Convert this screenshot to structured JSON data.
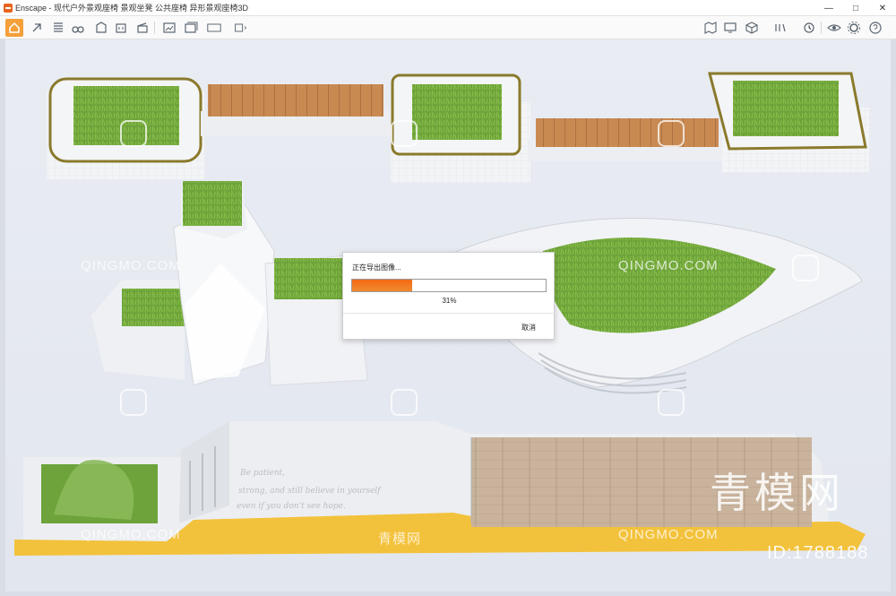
{
  "window": {
    "title": "Enscape - 现代户外景观座椅 景观坐凳 公共座椅 异形景观座椅3D",
    "controls": [
      "—",
      "□",
      "✕"
    ]
  },
  "toolbar": {
    "icons": [
      "home-icon",
      "asset-icon",
      "batch-icon",
      "bim-icon",
      "binoculars-icon",
      "building-icon",
      "gallery-icon",
      "clapper-icon",
      "export-image-icon",
      "export-batch-icon",
      "export-360-icon",
      "export-web-icon",
      "map-icon",
      "monitor-icon",
      "cube-icon",
      "vr-icon",
      "settings-advanced-icon",
      "eye-icon",
      "gear-icon",
      "help-icon"
    ]
  },
  "scene": {
    "inscription": [
      "Be patient,",
      "strong, and still believe in yourself",
      "even if you don't see hope."
    ]
  },
  "watermarks": {
    "text": "QINGMO.COM",
    "cn": "青模网",
    "id": "ID:1788188"
  },
  "dialog": {
    "title": "正在导出图像...",
    "progress": 0.31,
    "percent_text": "31%",
    "cancel_label": "取消",
    "fill_color": "#f36b16"
  }
}
